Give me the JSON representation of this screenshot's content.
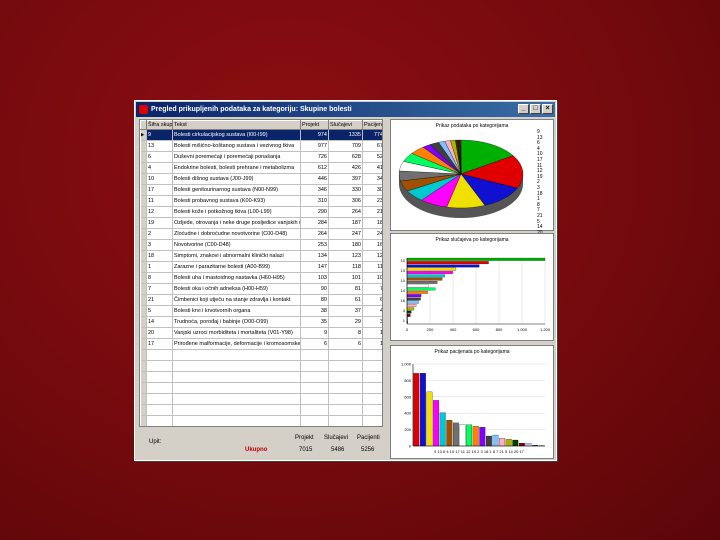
{
  "window": {
    "title": "Pregled prikupljenih podataka za kategoriju: Skupine bolesti",
    "btn_min": "_",
    "btn_max": "□",
    "btn_close": "×"
  },
  "grid": {
    "columns": [
      "Šifra skupine",
      "Tekst",
      "Projekt",
      "Slučajevi",
      "Pacijenti"
    ],
    "rows": [
      [
        "9",
        "Bolesti cirkulacijskog sustava (I00-I99)",
        "974",
        "1335",
        "774"
      ],
      [
        "13",
        "Bolesti mišićno-koštanog sustava i vezivnog tkiva",
        "977",
        "709",
        "67"
      ],
      [
        "6",
        "Duševni poremećaji i poremećaji ponašanja",
        "726",
        "628",
        "52"
      ],
      [
        "4",
        "Endokrine bolesti, bolesti prehrane i metabolizma",
        "612",
        "426",
        "41"
      ],
      [
        "10",
        "Bolesti dišnog sustava (J00-J99)",
        "446",
        "397",
        "34"
      ],
      [
        "17",
        "Bolesti genitourinarnog sustava (N00-N99)",
        "346",
        "330",
        "30"
      ],
      [
        "11",
        "Bolesti probavnog sustava (K00-K93)",
        "310",
        "306",
        "23"
      ],
      [
        "12",
        "Bolesti kože i potkožnog tkiva (L00-L99)",
        "290",
        "264",
        "21"
      ],
      [
        "19",
        "Ozljede, otrovanja i neke druge posljedice vanjskih uzroka",
        "284",
        "187",
        "18"
      ],
      [
        "2",
        "Zloćudne i dobroćudne novotvorine (C00-D48)",
        "264",
        "247",
        "24"
      ],
      [
        "3",
        "Novotvorine (C00-D48)",
        "253",
        "180",
        "16"
      ],
      [
        "18",
        "Simptomi, znakovi i abnormalni klinički nalazi",
        "134",
        "123",
        "12"
      ],
      [
        "1",
        "Zarazne i parazitarne bolesti (A00-B99)",
        "147",
        "118",
        "11"
      ],
      [
        "8",
        "Bolesti uha i mastoidnog nastavka (H60-H95)",
        "103",
        "101",
        "10"
      ],
      [
        "7",
        "Bolesti oka i očnih adneksa (H00-H59)",
        "90",
        "81",
        "7"
      ],
      [
        "21",
        "Čimbenici koji utječu na stanje zdravlja i kontakt",
        "80",
        "61",
        "6"
      ],
      [
        "5",
        "Bolesti krvi i krvotvornih organa",
        "38",
        "37",
        "4"
      ],
      [
        "14",
        "Trudnoća, porođaj i babinje (O00-O99)",
        "35",
        "29",
        "3"
      ],
      [
        "20",
        "Vanjski uzroci morbiditeta i mortaliteta (V01-Y98)",
        "9",
        "8",
        "1"
      ],
      [
        "17",
        "Prirođene malformacije, deformacije i kromosomske abnormalnosti",
        "6",
        "6",
        "1"
      ]
    ]
  },
  "bottom": {
    "label": "Upit:",
    "total_label": "Ukupno",
    "hdr_projekt": "Projekt",
    "hdr_slucajevi": "Slučajevi",
    "hdr_pacijenti": "Pacijenti",
    "val_projekt": "7015",
    "val_slucajevi": "5486",
    "val_pacijenti": "5256"
  },
  "pie": {
    "title": "Prikaz podataka po kategorijama",
    "legend": [
      "9",
      "13",
      "6",
      "4",
      "10",
      "17",
      "11",
      "12",
      "19",
      "2",
      "3",
      "18",
      "1",
      "8",
      "7",
      "21",
      "5",
      "14",
      "20",
      "17"
    ]
  },
  "hbar": {
    "title": "Prikaz slučajeva po kategorijama",
    "axis_labels": [
      "0",
      "200",
      "400",
      "600",
      "800",
      "1.000",
      "1.200"
    ],
    "y_labels": [
      "10",
      "13",
      "10",
      "14",
      "16",
      "4",
      "1"
    ]
  },
  "vbar": {
    "title": "Prikaz pacijenata po kategorijama",
    "y_labels": [
      "1.000",
      "800",
      "600",
      "400",
      "200",
      "0"
    ],
    "x_labels": "9 13 6 4 10 17 11 12 19 2 3 18 1 8 7 21 5 14 20 17"
  },
  "chart_data": [
    {
      "type": "pie",
      "categories": [
        "9",
        "13",
        "6",
        "4",
        "10",
        "17",
        "11",
        "12",
        "19",
        "2",
        "3",
        "18",
        "1",
        "8",
        "7",
        "21",
        "5",
        "14",
        "20",
        "17"
      ],
      "values": [
        974,
        977,
        726,
        612,
        446,
        346,
        310,
        290,
        284,
        264,
        253,
        134,
        147,
        103,
        90,
        80,
        38,
        35,
        9,
        6
      ],
      "colors": [
        "#00b000",
        "#e00000",
        "#1010d0",
        "#f0e000",
        "#ff00ff",
        "#00c8d0",
        "#a05000",
        "#707070",
        "#ffffff",
        "#00ff60",
        "#ff8000",
        "#8000ff",
        "#404040",
        "#80c0ff",
        "#ffb0c0",
        "#b0b000",
        "#004000",
        "#800000",
        "#c0c0ff",
        "#000080"
      ],
      "legend": "right"
    },
    {
      "type": "bar",
      "orientation": "horizontal",
      "values": [
        1335,
        709,
        628,
        426,
        397,
        330,
        306,
        264,
        187,
        247,
        180,
        123,
        118,
        101,
        81,
        61,
        37,
        29,
        8,
        6
      ],
      "xlim": [
        0,
        1200
      ]
    },
    {
      "type": "bar",
      "values": [
        974,
        977,
        726,
        612,
        446,
        346,
        310,
        290,
        284,
        264,
        253,
        134,
        147,
        103,
        90,
        80,
        38,
        35,
        9,
        6
      ],
      "ylim": [
        0,
        1100
      ]
    }
  ]
}
